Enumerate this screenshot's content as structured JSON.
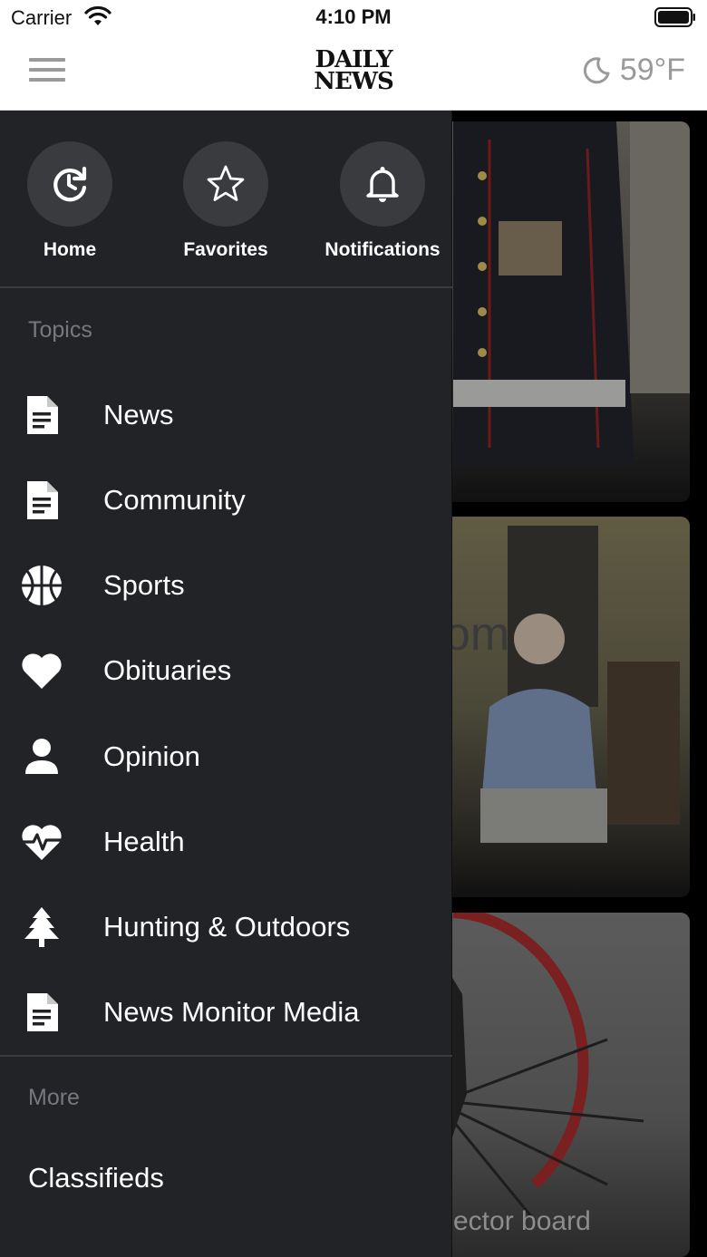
{
  "status_bar": {
    "carrier": "Carrier",
    "time": "4:10 PM"
  },
  "header": {
    "logo_line1": "DAILY",
    "logo_line2": "NEWS",
    "temperature": "59°F",
    "weather_icon": "moon-icon"
  },
  "drawer": {
    "quick_actions": [
      {
        "label": "Home",
        "icon": "history-icon"
      },
      {
        "label": "Favorites",
        "icon": "star-icon"
      },
      {
        "label": "Notifications",
        "icon": "bell-icon"
      }
    ],
    "topics_title": "Topics",
    "topics": [
      {
        "label": "News",
        "icon": "document-icon"
      },
      {
        "label": "Community",
        "icon": "document-icon"
      },
      {
        "label": "Sports",
        "icon": "basketball-icon"
      },
      {
        "label": "Obituaries",
        "icon": "heart-icon"
      },
      {
        "label": "Opinion",
        "icon": "person-icon"
      },
      {
        "label": "Health",
        "icon": "heartbeat-icon"
      },
      {
        "label": "Hunting & Outdoors",
        "icon": "tree-icon"
      },
      {
        "label": "News Monitor Media",
        "icon": "document-icon"
      }
    ],
    "more_title": "More",
    "more_items": [
      {
        "label": "Classifieds"
      }
    ]
  },
  "feed": {
    "card2_text": "om",
    "card3_text": "ector board"
  }
}
